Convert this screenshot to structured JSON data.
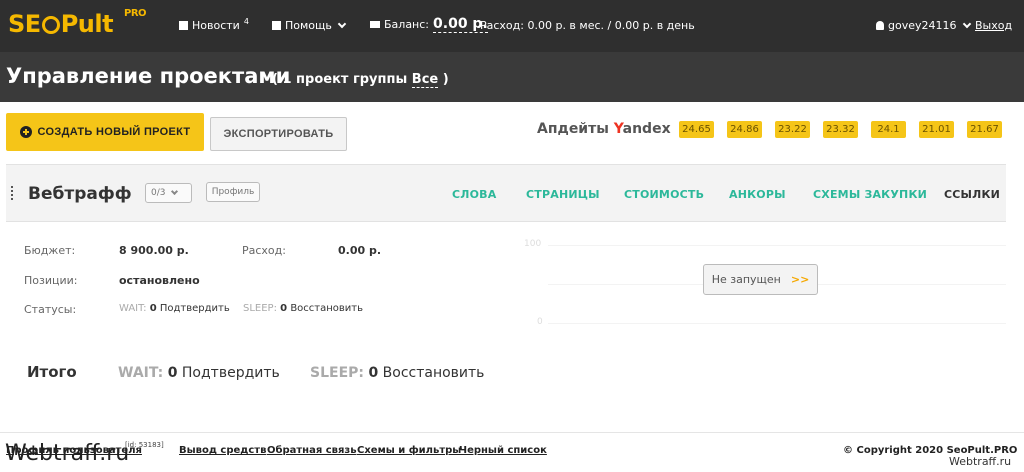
{
  "header": {
    "logo_seo": "SE",
    "logo_pult": "Pult",
    "logo_pro": "PRO",
    "news_label": "Новости",
    "news_count": "4",
    "help_label": "Помощь",
    "balance_label": "Баланс:",
    "balance_value": "0.00 р.",
    "expense_text": "Расход: 0.00 р. в мес. / 0.00 р. в день",
    "username": "govey24116",
    "logout_label": "Выход"
  },
  "title_bar": {
    "title": "Управление проектами",
    "subtitle_prefix": "( 1 проект группы",
    "group_name": "Все",
    "subtitle_suffix": ")"
  },
  "toolbar": {
    "create_label": "СОЗДАТЬ НОВЫЙ ПРОЕКТ",
    "export_label": "ЭКСПОРТИРОВАТЬ",
    "updates_prefix": "Апдейты",
    "updates_y": "Y",
    "updates_brand": "andex",
    "updates": [
      "24.65",
      "24.86",
      "23.22",
      "23.32",
      "24.1",
      "21.01",
      "21.67"
    ]
  },
  "project": {
    "name": "Вебтрафф",
    "select_value": "0/3",
    "profile_label": "Профиль",
    "tabs": [
      "СЛОВА",
      "СТРАНИЦЫ",
      "СТОИМОСТЬ",
      "АНКОРЫ",
      "СХЕМЫ ЗАКУПКИ",
      "ССЫЛКИ"
    ],
    "budget_label": "Бюджет:",
    "budget_value": "8 900.00 р.",
    "expense_label": "Расход:",
    "expense_value": "0.00 р.",
    "positions_label": "Позиции:",
    "positions_value": "остановлено",
    "statuses_label": "Статусы:",
    "wait_key": "WAIT:",
    "wait_count": "0",
    "wait_action": "Подтвердить",
    "sleep_key": "SLEEP:",
    "sleep_count": "0",
    "sleep_action": "Восстановить",
    "chart_max": "100",
    "chart_min": "0",
    "run_label": "Не запущен",
    "run_arrow": ">>"
  },
  "totals": {
    "label": "Итого",
    "wait_key": "WAIT:",
    "wait_count": "0",
    "wait_action": "Подтвердить",
    "sleep_key": "SLEEP:",
    "sleep_count": "0",
    "sleep_action": "Восстановить"
  },
  "footer": {
    "profile_link": "Профиль пользователя",
    "user_id": "[id: 53183]",
    "links": [
      "Вывод средств",
      "Обратная связь",
      "Схемы и фильтры",
      "Черный список"
    ],
    "copyright": "© Copyright 2020 SeoPult.PRO",
    "watermark_left": "Webtraff.ru",
    "watermark_right": "Webtraff.ru"
  }
}
